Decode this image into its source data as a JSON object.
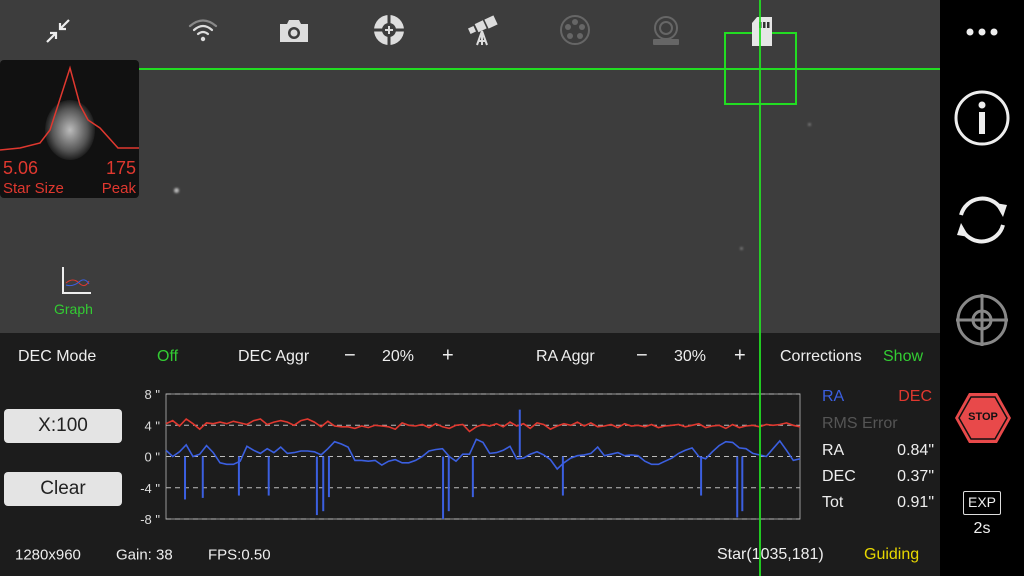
{
  "toolbar": {
    "icons": [
      "collapse-icon",
      "wifi-icon",
      "camera-icon",
      "target-icon",
      "telescope-icon",
      "filter-wheel-icon",
      "rotator-icon",
      "sd-card-icon"
    ]
  },
  "star_profile": {
    "size": "5.06",
    "size_label": "Star Size",
    "peak": "175",
    "peak_label": "Peak"
  },
  "graph_button": {
    "label": "Graph"
  },
  "controls": {
    "dec_mode_label": "DEC Mode",
    "dec_mode_value": "Off",
    "dec_aggr_label": "DEC Aggr",
    "dec_aggr_value": "20%",
    "ra_aggr_label": "RA Aggr",
    "ra_aggr_value": "30%",
    "minus": "−",
    "plus": "+",
    "corrections_label": "Corrections",
    "corrections_value": "Show"
  },
  "buttons": {
    "scale": "X:100",
    "clear": "Clear"
  },
  "stats": {
    "ra_legend": "RA",
    "dec_legend": "DEC",
    "rms_label": "RMS Error",
    "ra_label": "RA",
    "ra_value": "0.84\"",
    "dec_label": "DEC",
    "dec_value": "0.37\"",
    "tot_label": "Tot",
    "tot_value": "0.91\""
  },
  "status": {
    "resolution": "1280x960",
    "gain": "Gain: 38",
    "fps": "FPS:0.50",
    "star": "Star(1035,181)",
    "state": "Guiding"
  },
  "sidebar": {
    "stop": "STOP",
    "exp": "EXP",
    "exposure": "2s"
  },
  "colors": {
    "ra": "#3b5fe0",
    "dec": "#e0382f",
    "green": "#22dd22",
    "guiding": "#e8d800"
  },
  "chart_data": {
    "type": "line",
    "ylim": [
      -8,
      8
    ],
    "yticks": [
      "8 \"",
      "4 \"",
      "0 \"",
      "-4 \"",
      "-8 \""
    ],
    "ytick_values": [
      8,
      4,
      0,
      -4,
      -8
    ],
    "xlim": [
      0,
      100
    ],
    "series": [
      {
        "name": "RA",
        "values": [
          0.8,
          0,
          0.6,
          1.5,
          0,
          0.3,
          1.4,
          0.5,
          -0.8,
          -1,
          -1,
          -0.6,
          1.3,
          0.8,
          0.4,
          1,
          0.5,
          1.2,
          0.4,
          0.5,
          0.7,
          0.7,
          0.6,
          0.2,
          1,
          1.9,
          1.6,
          1.2,
          -0.5,
          -0.5,
          -0.6,
          -0.5,
          -1.1,
          -0.6,
          -0.4,
          -0.8,
          -0.8,
          -0.5,
          0,
          0.7,
          0.9,
          1,
          0,
          -0.6,
          0.3,
          0.3,
          2.2,
          1.8,
          0.4,
          0.5,
          0.8,
          1.3,
          -0.3,
          -0.2,
          0.3,
          0.6,
          0.2,
          -0.4,
          -1.6,
          -0.8,
          -0.2,
          0.1,
          0.2,
          0.4,
          1.2,
          0.1,
          0.3,
          0.5,
          0.1,
          0.2,
          0.1,
          -0.6,
          -1,
          -1,
          -0.6,
          -0.2,
          0.4,
          0.8,
          1.1,
          0,
          -0.3,
          0.6,
          1.4,
          1.9,
          1.8,
          1.1,
          1,
          0.4,
          0.2,
          0,
          1,
          2,
          0.8,
          -0.5,
          -0.3
        ]
      },
      {
        "name": "DEC",
        "values": [
          4.2,
          4.6,
          3.9,
          4.8,
          4.2,
          3.5,
          4.3,
          4.2,
          4.4,
          4.2,
          4.5,
          4.3,
          4.1,
          4.6,
          4.8,
          4.1,
          4.4,
          4.6,
          4.4,
          4.0,
          4.6,
          4.8,
          4.4,
          3.8,
          4.5,
          3.9,
          3.8,
          3.8,
          3.6,
          3.9,
          3.7,
          4.0,
          3.9,
          3.8,
          3.5,
          4.3,
          4.0,
          3.9,
          4.1,
          3.7,
          4.2,
          3.8,
          3.6,
          4.0,
          4.1,
          3.2,
          3.8,
          4.1,
          3.9,
          4.2,
          3.8,
          4.4,
          3.9,
          4.2,
          3.6,
          4.3,
          4.1,
          3.5,
          3.9,
          4.2,
          4.0,
          4.4,
          3.9,
          4.3,
          3.8,
          3.9,
          4.1,
          3.7,
          4.2,
          3.9,
          4.0,
          3.8,
          4.1,
          3.7,
          3.9,
          4.0,
          4.1,
          3.8,
          4.0,
          4.2,
          3.7,
          3.9,
          4.0,
          3.6,
          4.1,
          3.7,
          3.9,
          4.0,
          3.8,
          4.1,
          4.0,
          4.1,
          4.3,
          4.0,
          3.8
        ]
      }
    ],
    "corrections": [
      {
        "x": 3,
        "y": -5.5
      },
      {
        "x": 5.8,
        "y": -5.3
      },
      {
        "x": 11.5,
        "y": -5
      },
      {
        "x": 16.2,
        "y": -5
      },
      {
        "x": 23.8,
        "y": -7.5
      },
      {
        "x": 24.8,
        "y": -7
      },
      {
        "x": 25.7,
        "y": -5.2
      },
      {
        "x": 43.7,
        "y": -8
      },
      {
        "x": 44.6,
        "y": -7
      },
      {
        "x": 48.4,
        "y": -5.2
      },
      {
        "x": 55.8,
        "y": 6
      },
      {
        "x": 62.6,
        "y": -5
      },
      {
        "x": 84.4,
        "y": -5
      },
      {
        "x": 90.1,
        "y": -7.8
      },
      {
        "x": 90.9,
        "y": -7
      }
    ]
  }
}
